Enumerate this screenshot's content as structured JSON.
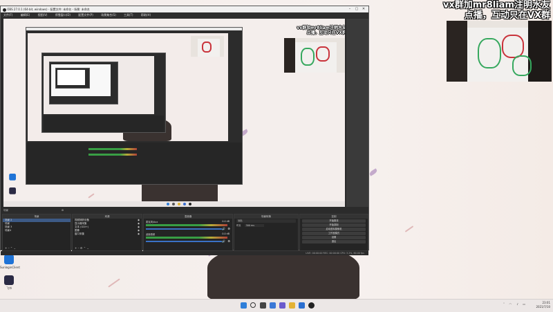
{
  "overlay": {
    "line1": "vx群加mr8liam注明水友",
    "line2": "点播，互动只在VX群"
  },
  "obs": {
    "window_title": "OBS 27.0.1 (64-bit, windows) - 配置文件: 未命名 - 场景: 未命名",
    "menu": [
      "文件(F)",
      "编辑(E)",
      "视图(V)",
      "停靠窗口(D)",
      "配置文件(P)",
      "场景集合(S)",
      "工具(T)",
      "帮助(H)"
    ],
    "label_scenes_panel": "场景",
    "docks": {
      "scenes": {
        "title": "场景",
        "items": [
          "场景 2",
          "场景",
          "场景 3",
          "场景4"
        ]
      },
      "sources": {
        "title": "来源",
        "items": [
          "视频捕获设备",
          "显示器采集",
          "文本 (GDI+)",
          "图像",
          "窗口采集"
        ]
      },
      "mixer": {
        "title": "混音器",
        "channels": [
          {
            "name": "麦克风/Aux",
            "db": "0.0 dB"
          },
          {
            "name": "桌面音频",
            "db": "0.0 dB"
          }
        ]
      },
      "transitions": {
        "title": "场景转换",
        "type": "淡出",
        "duration_label": "时长",
        "duration": "300 ms"
      },
      "controls": {
        "title": "控制",
        "buttons": [
          "开始推流",
          "开始录制",
          "启动虚拟摄像机",
          "工作室模式",
          "设置",
          "退出"
        ]
      }
    },
    "status": "LIVE: 00:00:00   REC: 00:00:00   CPU: 3.2%, 60.00 fps"
  },
  "desktop": {
    "icons": [
      {
        "label": "SunloginClient",
        "icon": "remote-icon",
        "color": "#1f73d6"
      },
      {
        "label": "飞书",
        "icon": "app-icon",
        "color": "#2a2a44"
      }
    ]
  },
  "taskbar": {
    "icons": [
      "windows-start-icon",
      "search-icon",
      "task-view-icon",
      "widgets-icon",
      "chat-icon",
      "file-explorer-icon",
      "store-icon",
      "obs-icon"
    ],
    "tray_icons": [
      "chevron-up-icon",
      "network-icon",
      "volume-icon",
      "battery-icon"
    ],
    "time": "23:01",
    "date": "2021/7/10"
  }
}
